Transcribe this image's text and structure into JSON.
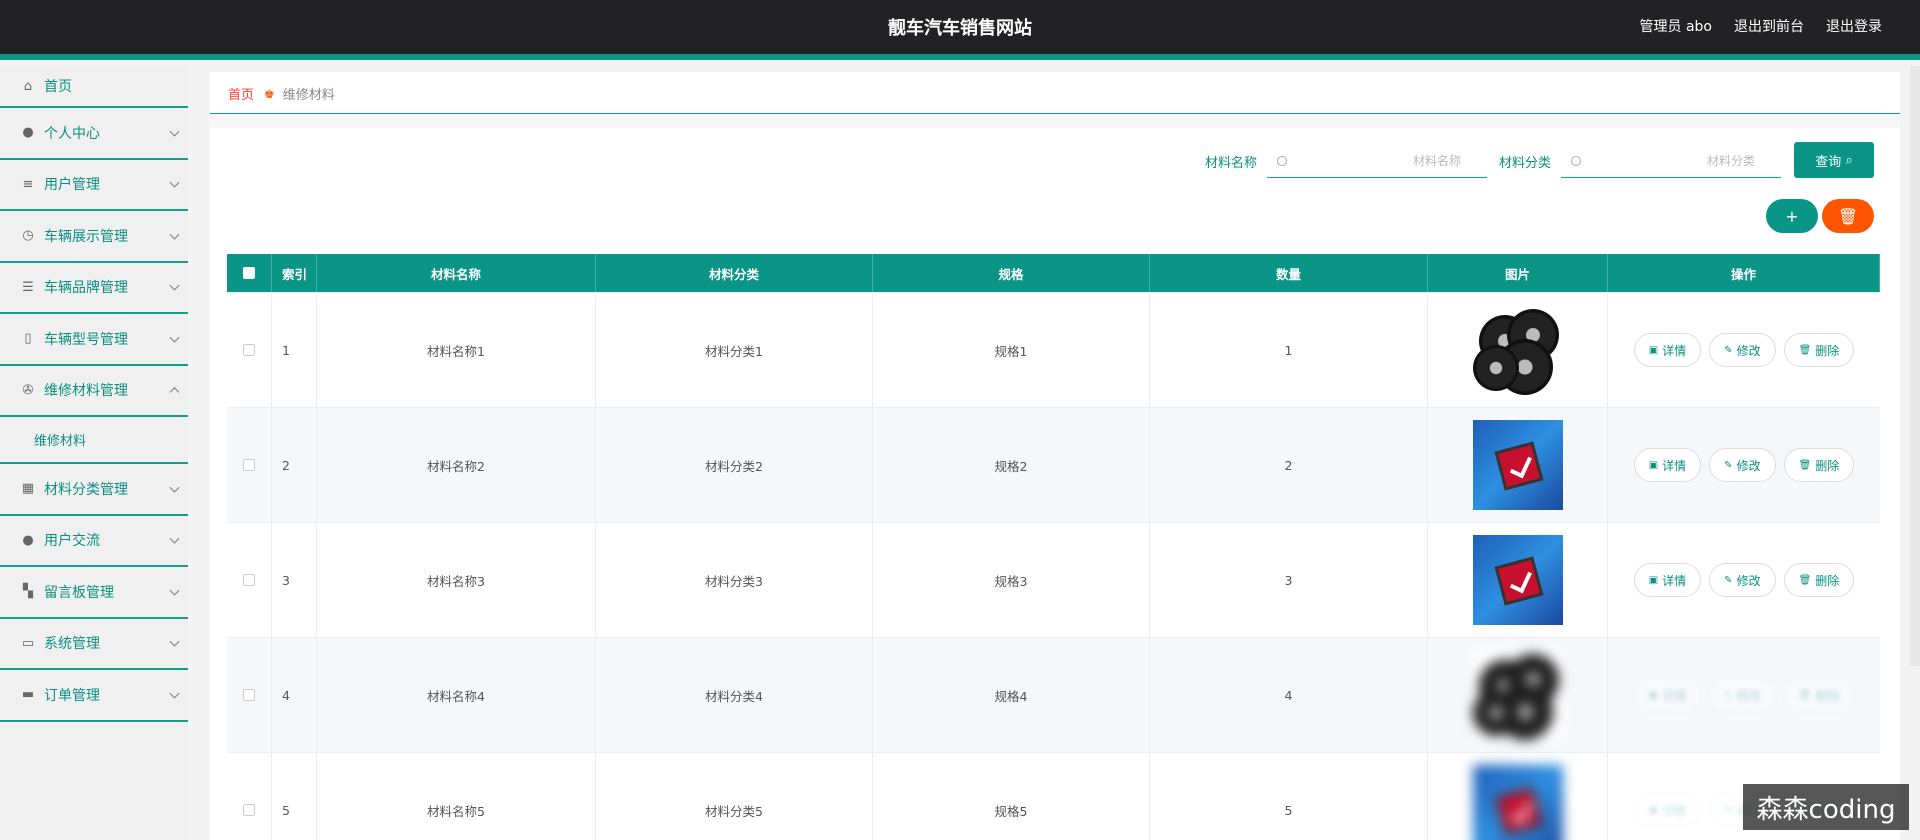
{
  "header": {
    "title": "靓车汽车销售网站",
    "user": "管理员 abo",
    "front": "退出到前台",
    "logout": "退出登录"
  },
  "sidebar": {
    "items": [
      {
        "label": "首页",
        "icon": "home-icon"
      },
      {
        "label": "个人中心",
        "icon": "user-icon"
      },
      {
        "label": "用户管理",
        "icon": "list-icon"
      },
      {
        "label": "车辆展示管理",
        "icon": "clock-icon"
      },
      {
        "label": "车辆品牌管理",
        "icon": "sliders-icon"
      },
      {
        "label": "车辆型号管理",
        "icon": "bulb-icon"
      },
      {
        "label": "维修材料管理",
        "icon": "wheel-icon"
      },
      {
        "label": "材料分类管理",
        "icon": "grid-icon"
      },
      {
        "label": "用户交流",
        "icon": "user-icon"
      },
      {
        "label": "留言板管理",
        "icon": "apps-icon"
      },
      {
        "label": "系统管理",
        "icon": "message-icon"
      },
      {
        "label": "订单管理",
        "icon": "chat-icon"
      }
    ],
    "submenu": "维修材料"
  },
  "breadcrumb": {
    "home": "首页",
    "current": "维修材料"
  },
  "search": {
    "name_label": "材料名称",
    "name_placeholder": "材料名称",
    "cat_label": "材料分类",
    "cat_placeholder": "材料分类",
    "query": "查询"
  },
  "table": {
    "headers": [
      "索引",
      "材料名称",
      "材料分类",
      "规格",
      "数量",
      "图片",
      "操作"
    ],
    "rows": [
      {
        "idx": "1",
        "name": "材料名称1",
        "cat": "材料分类1",
        "spec": "规格1",
        "num": "1",
        "img": "tire"
      },
      {
        "idx": "2",
        "name": "材料名称2",
        "cat": "材料分类2",
        "spec": "规格2",
        "num": "2",
        "img": "chip"
      },
      {
        "idx": "3",
        "name": "材料名称3",
        "cat": "材料分类3",
        "spec": "规格3",
        "num": "3",
        "img": "chip"
      },
      {
        "idx": "4",
        "name": "材料名称4",
        "cat": "材料分类4",
        "spec": "规格4",
        "num": "4",
        "img": "tire"
      },
      {
        "idx": "5",
        "name": "材料名称5",
        "cat": "材料分类5",
        "spec": "规格5",
        "num": "5",
        "img": "chip"
      }
    ],
    "ops": {
      "detail": "详情",
      "edit": "修改",
      "delete": "删除"
    }
  },
  "watermark": "森森coding"
}
